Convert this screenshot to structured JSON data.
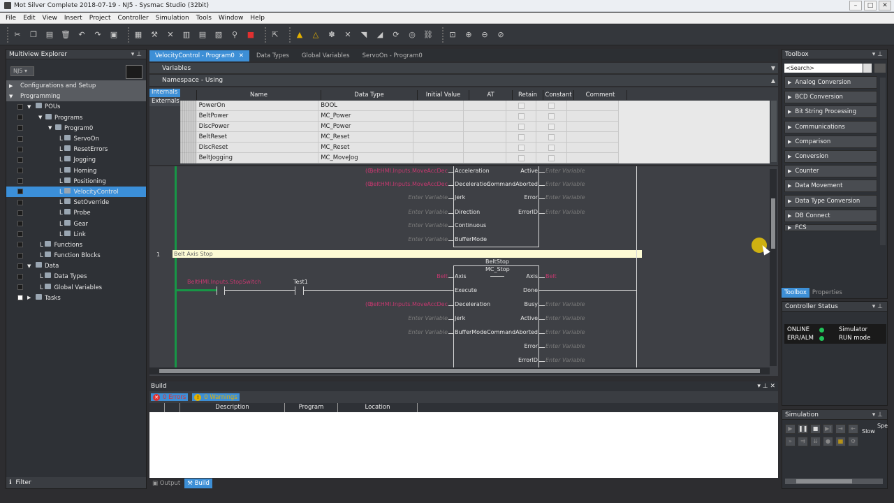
{
  "window": {
    "title": "Mot Silver Complete 2018-07-19 - NJ5 - Sysmac Studio (32bit)"
  },
  "menu": [
    "File",
    "Edit",
    "View",
    "Insert",
    "Project",
    "Controller",
    "Simulation",
    "Tools",
    "Window",
    "Help"
  ],
  "explorer": {
    "title": "Multiview Explorer",
    "device": "NJ5",
    "filter_label": "Filter",
    "tree": [
      {
        "label": "Configurations and Setup"
      },
      {
        "label": "Programming"
      },
      {
        "label": "POUs"
      },
      {
        "label": "Programs"
      },
      {
        "label": "Program0"
      },
      {
        "label": "ServoOn"
      },
      {
        "label": "ResetErrors"
      },
      {
        "label": "Jogging"
      },
      {
        "label": "Homing"
      },
      {
        "label": "Positioning"
      },
      {
        "label": "VelocityControl"
      },
      {
        "label": "SetOverride"
      },
      {
        "label": "Probe"
      },
      {
        "label": "Gear"
      },
      {
        "label": "Link"
      },
      {
        "label": "Functions"
      },
      {
        "label": "Function Blocks"
      },
      {
        "label": "Data"
      },
      {
        "label": "Data Types"
      },
      {
        "label": "Global Variables"
      },
      {
        "label": "Tasks"
      }
    ]
  },
  "editor": {
    "tabs": [
      {
        "label": "VelocityControl - Program0"
      },
      {
        "label": "Data Types"
      },
      {
        "label": "Global Variables"
      },
      {
        "label": "ServoOn - Program0"
      }
    ],
    "variables_label": "Variables",
    "namespace_label": "Namespace - Using",
    "var_tabs": [
      "Internals",
      "Externals"
    ],
    "columns": [
      "Name",
      "Data Type",
      "Initial Value",
      "AT",
      "Retain",
      "Constant",
      "Comment"
    ],
    "rows": [
      {
        "name": "PowerOn",
        "type": "BOOL"
      },
      {
        "name": "BeltPower",
        "type": "MC_Power"
      },
      {
        "name": "DiscPower",
        "type": "MC_Power"
      },
      {
        "name": "BeltReset",
        "type": "MC_Reset"
      },
      {
        "name": "DiscReset",
        "type": "MC_Reset"
      },
      {
        "name": "BeltJogging",
        "type": "MC_MoveJog"
      }
    ]
  },
  "ladder": {
    "block0": {
      "in_vars": [
        "BeltHMI.Inputs.MoveAccDec",
        "BeltHMI.Inputs.MoveAccDec",
        "Enter Variable",
        "Enter Variable",
        "Enter Variable",
        "Enter Variable"
      ],
      "in_prefix": [
        "(0)",
        "(0)"
      ],
      "in_pins": [
        "Acceleration",
        "Deceleration",
        "Jerk",
        "Direction",
        "Continuous",
        "BufferMode"
      ],
      "out_pins": [
        "Active",
        "CommandAborted",
        "Error",
        "ErrorID"
      ],
      "out_vars": [
        "Enter Variable",
        "Enter Variable",
        "Enter Variable",
        "Enter Variable"
      ]
    },
    "rung_number": "1",
    "rung_comment": "Belt Axis Stop",
    "contact1": "BeltHMI.Inputs.StopSwitch",
    "contact2": "Test1",
    "block1": {
      "instance": "BeltStop",
      "type": "MC_Stop",
      "axis_in": "Belt",
      "axis_out": "Belt",
      "in_pins": [
        "Axis",
        "Execute",
        "Deceleration",
        "Jerk",
        "BufferMode"
      ],
      "out_pins": [
        "Axis",
        "Done",
        "Busy",
        "Active",
        "CommandAborted",
        "Error",
        "ErrorID"
      ],
      "decel_prefix": "(0)",
      "decel_var": "BeltHMI.Inputs.MoveAccDec",
      "enter_variable": "Enter Variable"
    }
  },
  "build": {
    "title": "Build",
    "errors": "0 Errors",
    "warnings": "0 Warnings",
    "columns": [
      "Description",
      "Program",
      "Location"
    ],
    "bottom_tabs": [
      "Output",
      "Build"
    ]
  },
  "toolbox": {
    "title": "Toolbox",
    "search_placeholder": "<Search>",
    "items": [
      "Analog Conversion",
      "BCD Conversion",
      "Bit String Processing",
      "Communications",
      "Comparison",
      "Conversion",
      "Counter",
      "Data Movement",
      "Data Type Conversion",
      "DB Connect",
      "FCS"
    ],
    "tabs": [
      "Toolbox",
      "Properties"
    ]
  },
  "controller_status": {
    "title": "Controller Status",
    "online": "ONLINE",
    "online_state": "Simulator",
    "err": "ERR/ALM",
    "err_state": "RUN mode"
  },
  "simulation": {
    "title": "Simulation",
    "speed_slow": "Slow",
    "speed_label": "Spe"
  },
  "colors": {
    "accent": "#3d8fd6",
    "rail": "#179646",
    "var_text": "#c5386f"
  }
}
